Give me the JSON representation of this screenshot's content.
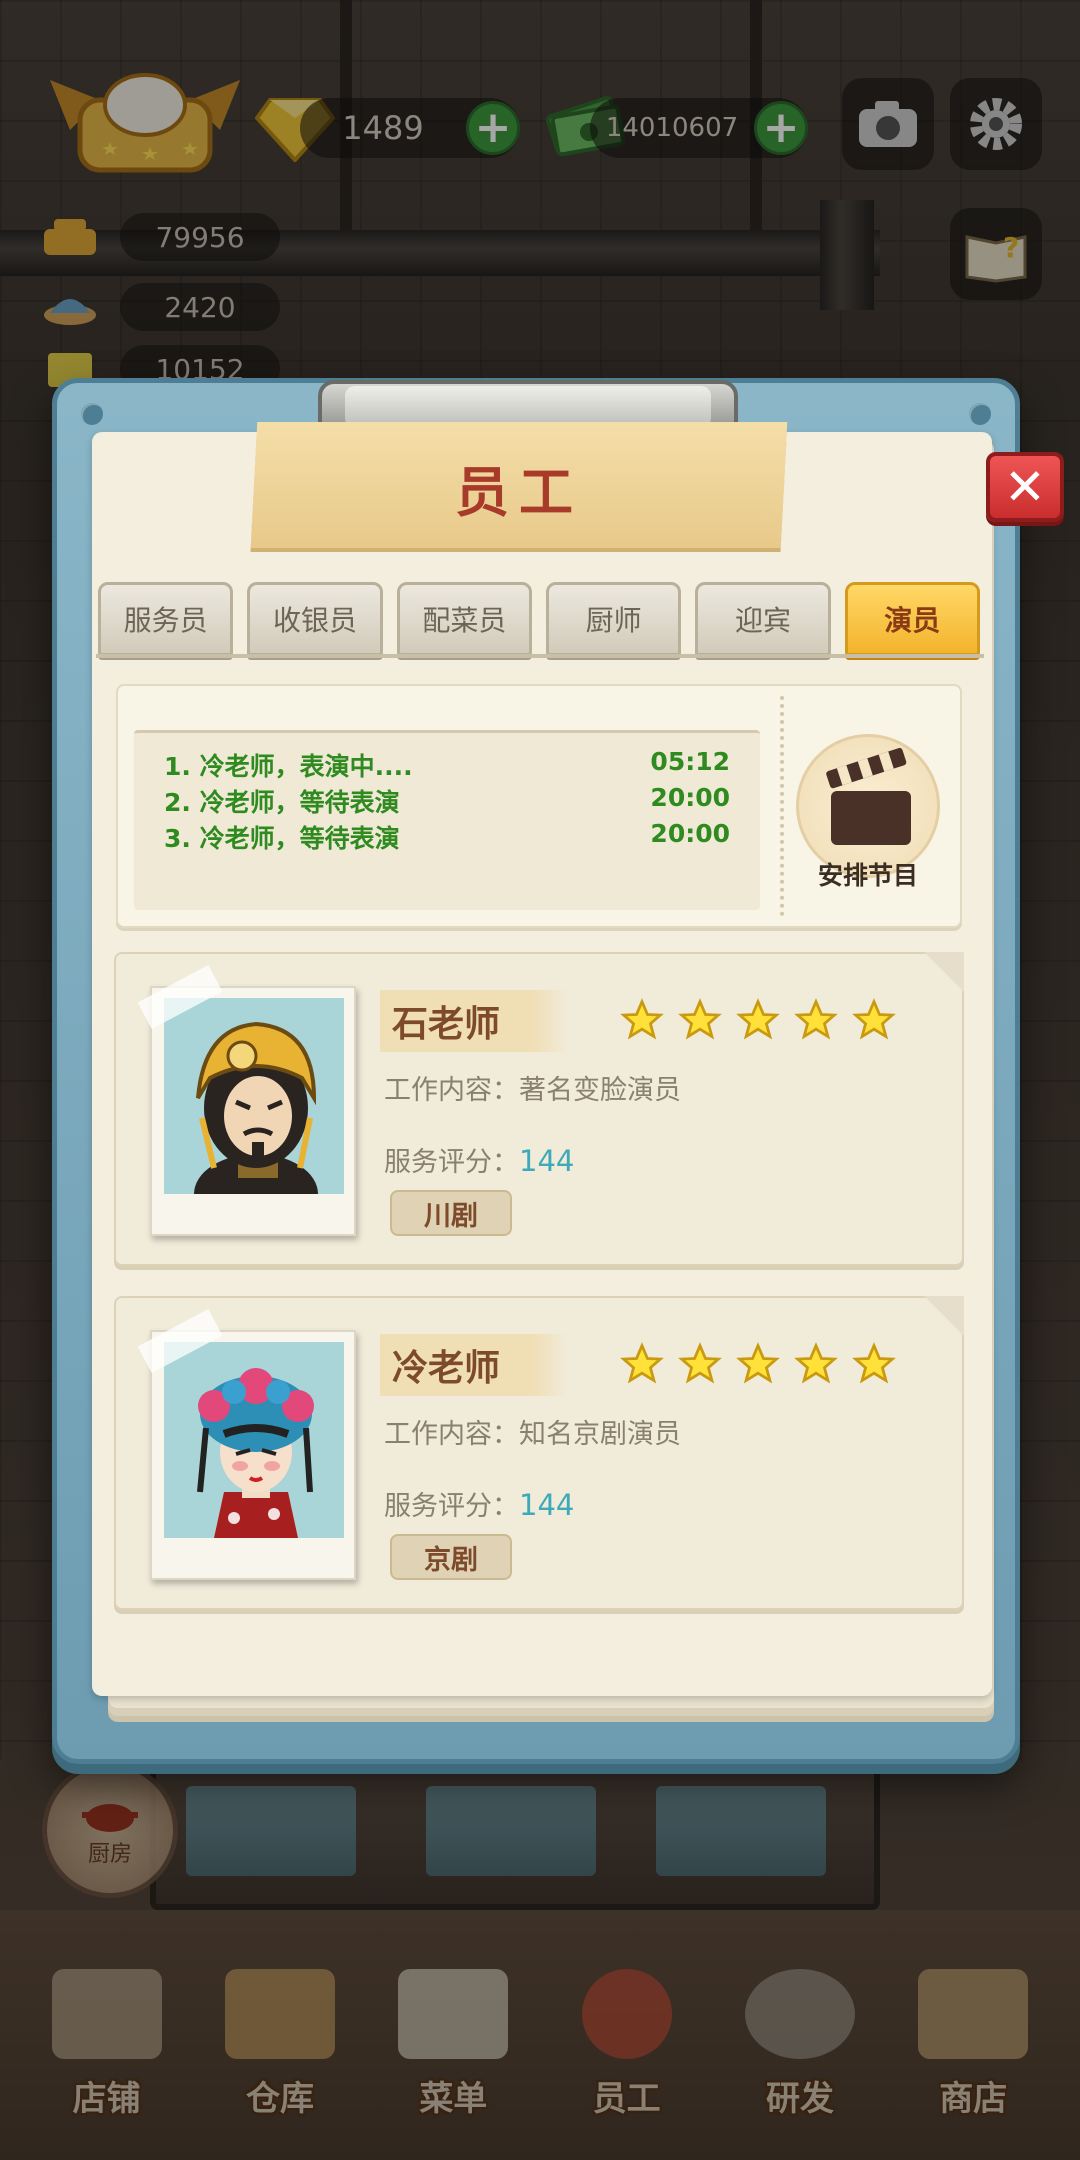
{
  "hud": {
    "gems": "1489",
    "cash": "14010607",
    "stats": [
      "79956",
      "2420",
      "10152"
    ]
  },
  "modal": {
    "title": "员工",
    "close_icon": "close-icon",
    "tabs": [
      {
        "label": "服务员",
        "active": false
      },
      {
        "label": "收银员",
        "active": false
      },
      {
        "label": "配菜员",
        "active": false
      },
      {
        "label": "厨师",
        "active": false
      },
      {
        "label": "迎宾",
        "active": false
      },
      {
        "label": "演员",
        "active": true
      }
    ],
    "schedule": [
      {
        "text": "1. 冷老师，表演中....",
        "time": "05:12"
      },
      {
        "text": "2. 冷老师，等待表演",
        "time": "20:00"
      },
      {
        "text": "3. 冷老师，等待表演",
        "time": "20:00"
      }
    ],
    "arrange_label": "安排节目",
    "performers": [
      {
        "name": "石老师",
        "stars": 5,
        "work_label": "工作内容：",
        "work": "著名变脸演员",
        "score_label": "服务评分：",
        "score": "144",
        "genre": "川剧"
      },
      {
        "name": "冷老师",
        "stars": 5,
        "work_label": "工作内容：",
        "work": "知名京剧演员",
        "score_label": "服务评分：",
        "score": "144",
        "genre": "京剧"
      }
    ]
  },
  "kitchen_button": "厨房",
  "nav": [
    "店铺",
    "仓库",
    "菜单",
    "员工",
    "研发",
    "商店"
  ],
  "colors": {
    "board_blue": "#8ab6c8",
    "tab_active": "#f3b42d",
    "schedule_green": "#2f8a1f",
    "score_teal": "#3ea9b8",
    "close_red": "#e04040",
    "title_red": "#a83a2a"
  }
}
